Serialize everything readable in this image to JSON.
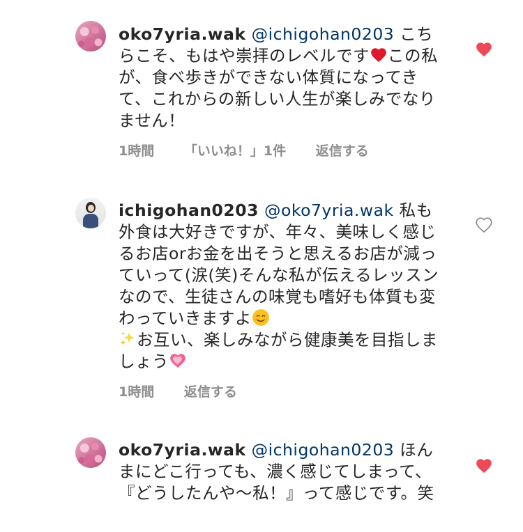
{
  "comments": [
    {
      "username": "oko7yria.wak",
      "mention": "@ichigohan0203",
      "text_before_emoji": "こちらこそ、もはや崇拝のレベルです",
      "emoji_1": "heart-emoji",
      "text_after_emoji": "この私が、食べ歩きができない体質になってきて、これからの新しい人生が楽しみでなりません！",
      "time": "1時間",
      "likes": "「いいね！」1件",
      "reply": "返信する",
      "liked": true,
      "like_color": "#ed4956"
    },
    {
      "username": "ichigohan0203",
      "mention": "@oko7yria.wak",
      "text_before_emoji": "私も外食は大好きですが、年々、美味しく感じるお店orお金を出そうと思えるお店が減っていって(涙(笑)そんな私が伝えるレッスンなので、生徒さんの味覚も嗜好も体質も変わっていきますよ",
      "emoji_1": "smiling-face-emoji",
      "emoji_2": "sparkles-emoji",
      "text_after_emoji": "お互い、楽しみながら健康美を目指しましょう",
      "emoji_3": "growing-heart-emoji",
      "time": "1時間",
      "reply": "返信する",
      "liked": false
    },
    {
      "username": "oko7yria.wak",
      "mention": "@ichigohan0203",
      "text": "ほんまにどこ行っても、濃く感じてしまって、『どうしたんや〜私！』って感じです。笑",
      "liked": true,
      "like_color": "#ed4956"
    }
  ]
}
